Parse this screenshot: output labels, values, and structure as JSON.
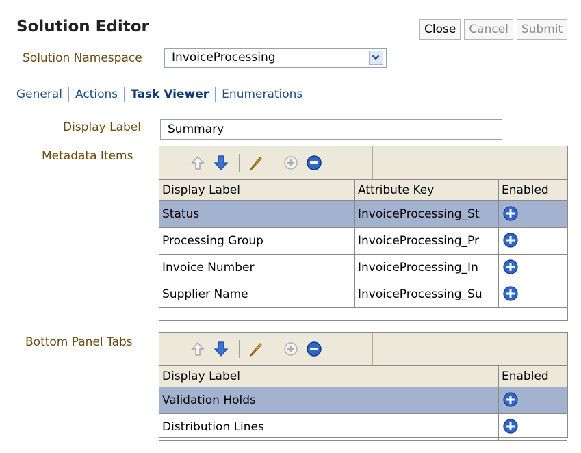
{
  "header": {
    "title": "Solution Editor",
    "buttons": {
      "close": "Close",
      "cancel": "Cancel",
      "submit": "Submit"
    }
  },
  "namespace": {
    "label": "Solution Namespace",
    "value": "InvoiceProcessing"
  },
  "tabs": [
    "General",
    "Actions",
    "Task Viewer",
    "Enumerations"
  ],
  "active_tab": "Task Viewer",
  "display_label": {
    "label": "Display Label",
    "value": "Summary"
  },
  "metadata_items": {
    "label": "Metadata Items",
    "columns": [
      "Display Label",
      "Attribute Key",
      "Enabled"
    ],
    "rows": [
      {
        "label": "Status",
        "key": "InvoiceProcessing_St",
        "selected": true
      },
      {
        "label": "Processing Group",
        "key": "InvoiceProcessing_Pr",
        "selected": false
      },
      {
        "label": "Invoice Number",
        "key": "InvoiceProcessing_In",
        "selected": false
      },
      {
        "label": "Supplier Name",
        "key": "InvoiceProcessing_Su",
        "selected": false
      }
    ]
  },
  "bottom_panel_tabs": {
    "label": "Bottom Panel Tabs",
    "columns": [
      "Display Label",
      "Enabled"
    ],
    "rows": [
      {
        "label": "Validation Holds",
        "selected": true
      },
      {
        "label": "Distribution Lines",
        "selected": false
      }
    ]
  },
  "toolbar_icons": [
    "move-up-icon",
    "move-down-icon",
    "edit-icon",
    "add-icon",
    "remove-icon"
  ],
  "colors": {
    "label_brown": "#6b4b10",
    "link_blue": "#1d4e8a",
    "selected_row": "#a3b3cf",
    "toolbar_bg": "#ece8da"
  }
}
